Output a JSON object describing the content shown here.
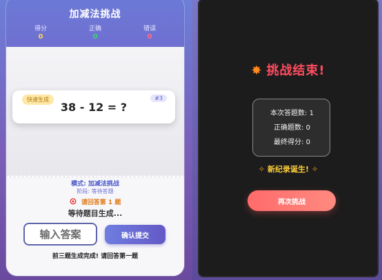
{
  "game": {
    "title": "加减法挑战",
    "stats": [
      {
        "label": "得分",
        "value": "0"
      },
      {
        "label": "正确",
        "value": "0"
      },
      {
        "label": "错误",
        "value": "0"
      }
    ],
    "question": {
      "tag": "快速生成",
      "number": "#3",
      "text": "38 - 12 = ?"
    },
    "mode": "模式: 加减法挑战",
    "stage": "阶段: 等待答题",
    "prompt": "请回答第 1 题",
    "waiting": "等待题目生成...",
    "answer_placeholder": "输入答案",
    "submit_label": "确认提交",
    "footer_message": "前三题生成完成! 请回答第一题"
  },
  "end": {
    "title": "挑战结束!",
    "lines": [
      "本次答题数: 1",
      "正确题数: 0",
      "最终得分: 0"
    ],
    "record": "新纪录诞生!",
    "retry_label": "再次挑战"
  },
  "colors": {
    "accent": "#6c7ad6",
    "end_title": "#ff4d5f",
    "record": "#ffcf3a",
    "retry": "#ff6b6b"
  },
  "icons": {
    "target": "target-icon",
    "boom": "explosion-icon",
    "party": "party-popper-icon"
  }
}
